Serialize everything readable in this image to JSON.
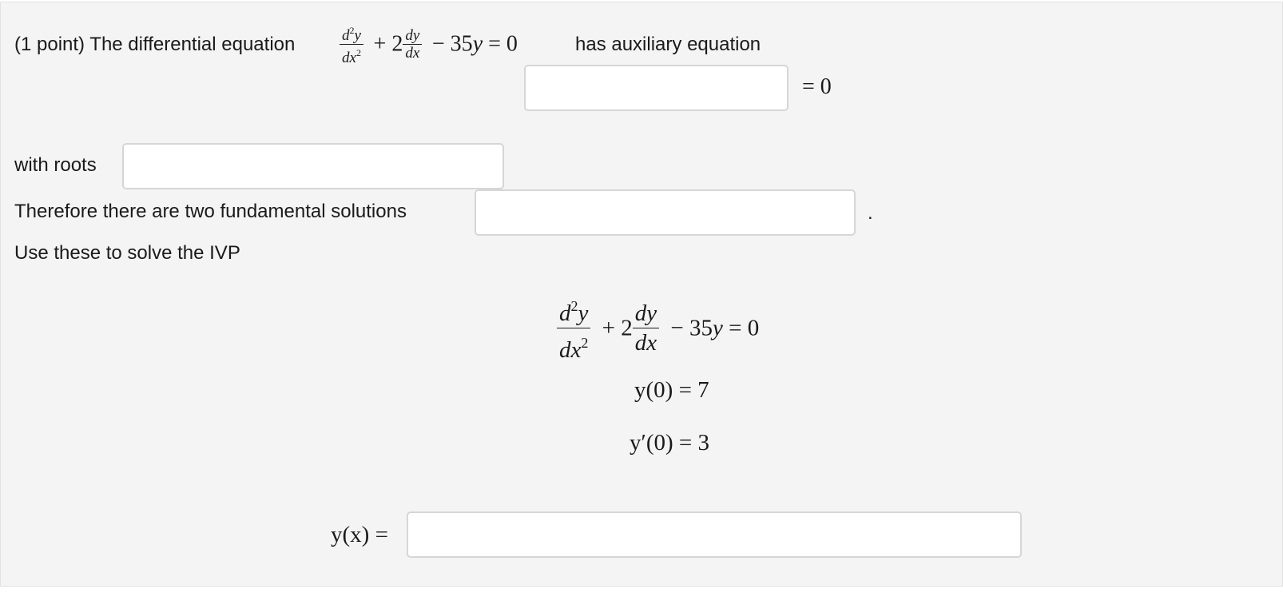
{
  "problem": {
    "intro": "(1 point) The differential equation",
    "has_aux": "has auxiliary equation",
    "eq_zero": "= 0",
    "with_roots": "with roots",
    "fundamental": "Therefore there are two fundamental solutions",
    "period": ".",
    "use_these": "Use these to solve the IVP",
    "ode_tail": "− 35y = 0",
    "ic1": "y(0) = 7",
    "ic2": "y′(0) = 3",
    "yx": "y(x) ="
  },
  "inputs": {
    "aux_value": "",
    "roots_value": "",
    "fundamental_value": "",
    "solution_value": ""
  }
}
